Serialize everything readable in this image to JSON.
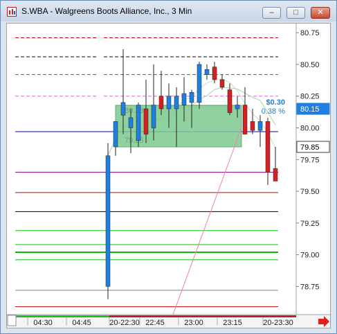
{
  "window": {
    "title": "S.WBA - Walgreens Boots Alliance, Inc., 3 Min",
    "controls": {
      "minimize": "–",
      "maximize": "□",
      "close": "✕"
    }
  },
  "chart_data": {
    "type": "candlestick",
    "ylim": [
      78.55,
      80.8
    ],
    "y_ticks": [
      "80.75",
      "80.50",
      "80.25",
      "80.00",
      "79.75",
      "79.50",
      "79.25",
      "79.00",
      "78.75"
    ],
    "x_ticks": [
      "04:30",
      "04:45",
      "20-22:30",
      "22:45",
      "23:00",
      "23:15",
      "20-23:30"
    ],
    "price_badges": [
      {
        "value": 80.15,
        "label": "80.15",
        "style": "current"
      },
      {
        "value": 79.85,
        "label": "79.85",
        "style": "marker"
      }
    ],
    "position_box": {
      "entry_label": "80.18",
      "exit_label": "79.85",
      "change": "$0.30",
      "change_pct": "0.38 %"
    },
    "candles": [
      {
        "o": 78.75,
        "h": 79.88,
        "l": 78.65,
        "c": 79.78
      },
      {
        "o": 79.85,
        "h": 80.0,
        "l": 79.78,
        "c": 80.05
      },
      {
        "o": 80.1,
        "h": 80.62,
        "l": 79.95,
        "c": 80.2
      },
      {
        "o": 80.0,
        "h": 80.15,
        "l": 79.8,
        "c": 80.08
      },
      {
        "o": 79.9,
        "h": 80.2,
        "l": 79.85,
        "c": 80.18
      },
      {
        "o": 80.15,
        "h": 80.38,
        "l": 79.88,
        "c": 79.95
      },
      {
        "o": 80.0,
        "h": 80.5,
        "l": 79.9,
        "c": 80.18
      },
      {
        "o": 80.25,
        "h": 80.45,
        "l": 80.1,
        "c": 80.15
      },
      {
        "o": 80.15,
        "h": 80.35,
        "l": 80.0,
        "c": 80.25
      },
      {
        "o": 80.15,
        "h": 80.32,
        "l": 79.85,
        "c": 80.25
      },
      {
        "o": 80.18,
        "h": 80.4,
        "l": 80.05,
        "c": 80.27
      },
      {
        "o": 80.2,
        "h": 80.3,
        "l": 80.0,
        "c": 80.28
      },
      {
        "o": 80.2,
        "h": 80.52,
        "l": 80.15,
        "c": 80.5
      },
      {
        "o": 80.42,
        "h": 80.5,
        "l": 80.38,
        "c": 80.46
      },
      {
        "o": 80.48,
        "h": 80.52,
        "l": 80.35,
        "c": 80.38
      },
      {
        "o": 80.38,
        "h": 80.42,
        "l": 80.3,
        "c": 80.32
      },
      {
        "o": 80.3,
        "h": 80.35,
        "l": 80.1,
        "c": 80.12
      },
      {
        "o": 80.15,
        "h": 80.25,
        "l": 80.08,
        "c": 80.18
      },
      {
        "o": 80.18,
        "h": 80.32,
        "l": 79.95,
        "c": 79.95
      },
      {
        "o": 80.05,
        "h": 80.15,
        "l": 79.95,
        "c": 79.98
      },
      {
        "o": 79.98,
        "h": 80.1,
        "l": 79.85,
        "c": 80.05
      },
      {
        "o": 80.05,
        "h": 80.08,
        "l": 79.55,
        "c": 79.65
      },
      {
        "o": 79.68,
        "h": 79.85,
        "l": 79.58,
        "c": 79.58
      }
    ],
    "levels": [
      {
        "value": 80.71,
        "color": "#c00000",
        "dash": true
      },
      {
        "value": 80.56,
        "color": "#000000",
        "dash": true
      },
      {
        "value": 80.42,
        "color": "#00a000",
        "dash": true
      },
      {
        "value": 80.25,
        "color": "#d070d0",
        "dash": true
      },
      {
        "value": 79.97,
        "color": "#0000c0",
        "dash": false
      },
      {
        "value": 79.65,
        "color": "#800080",
        "dash": false
      },
      {
        "value": 79.49,
        "color": "#c00000",
        "dash": false
      },
      {
        "value": 79.34,
        "color": "#000000",
        "dash": false
      },
      {
        "value": 79.19,
        "color": "#00c000",
        "dash": false
      },
      {
        "value": 79.08,
        "color": "#00c000",
        "dash": false
      },
      {
        "value": 79.02,
        "color": "#00c000",
        "dash": false,
        "thick": true
      },
      {
        "value": 78.96,
        "color": "#00c000",
        "dash": false
      },
      {
        "value": 78.72,
        "color": "#808080",
        "dash": false
      },
      {
        "value": 78.59,
        "color": "#c00000",
        "dash": false
      }
    ]
  }
}
